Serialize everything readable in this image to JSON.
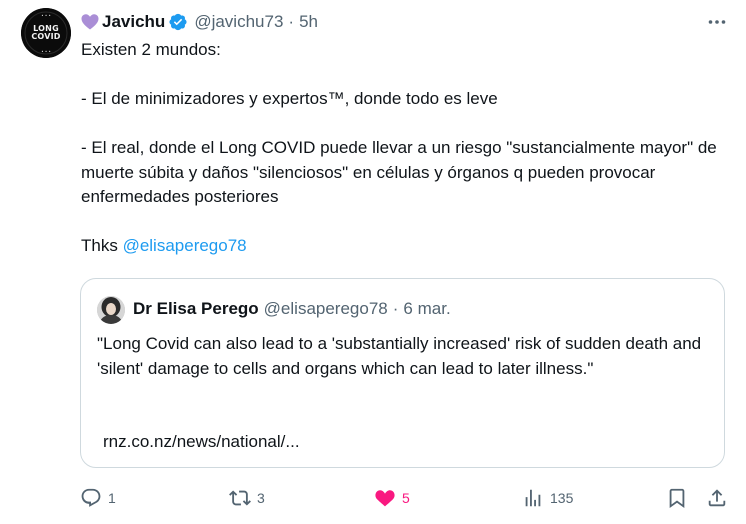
{
  "author": {
    "display_name": "Javichu",
    "handle": "@javichu73",
    "separator": "·",
    "time": "5h",
    "avatar": {
      "label": "LONG COVID",
      "ring_text": "LONG COVID AWARENESS"
    }
  },
  "tweet": {
    "lines": [
      "Existen 2 mundos:",
      "-  El de minimizadores y expertos™, donde todo es leve",
      "- El real, donde el Long COVID puede llevar a un riesgo \"sustancialmente mayor\" de muerte súbita y daños \"silenciosos\" en células y órganos q pueden provocar enfermedades posteriores",
      "Thks "
    ],
    "mention": "@elisaperego78"
  },
  "quote": {
    "display_name": "Dr Elisa Perego",
    "handle": "@elisaperego78",
    "separator": "·",
    "date": "6 mar.",
    "text": "\"Long Covid can also lead to a 'substantially increased' risk of sudden death and 'silent' damage to cells and organs which can lead to later illness.\"",
    "link": "rnz.co.nz/news/national/..."
  },
  "actions": {
    "replies": "1",
    "retweets": "3",
    "likes": "5",
    "views": "135"
  },
  "colors": {
    "text": "#0f1419",
    "secondary": "#536471",
    "link": "#1d9bf0",
    "like": "#f91880",
    "verified": "#1d9bf0",
    "purple_heart": "#aa8ed6",
    "border": "#cfd9de"
  },
  "icons": {
    "heart_emoji": "purple-heart-icon",
    "verified": "verified-badge-icon",
    "more": "more-options-icon",
    "reply": "reply-icon",
    "retweet": "retweet-icon",
    "like": "like-heart-icon",
    "views": "views-chart-icon",
    "bookmark": "bookmark-icon",
    "share": "share-icon"
  }
}
